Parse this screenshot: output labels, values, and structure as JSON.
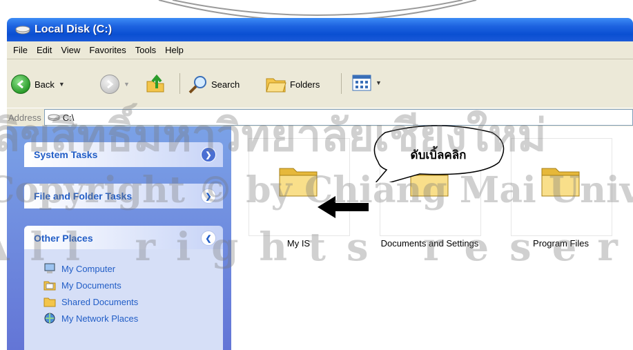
{
  "window": {
    "title": "Local Disk (C:)"
  },
  "menu": [
    "File",
    "Edit",
    "View",
    "Favorites",
    "Tools",
    "Help"
  ],
  "toolbar": {
    "back_label": "Back",
    "search_label": "Search",
    "folders_label": "Folders"
  },
  "address": {
    "label": "Address",
    "value": "C:\\"
  },
  "left_pane": {
    "system_tasks": "System Tasks",
    "file_folder_tasks": "File and Folder Tasks",
    "other_places": "Other Places",
    "other_links": [
      "My Computer",
      "My Documents",
      "Shared Documents",
      "My Network Places"
    ]
  },
  "folders": [
    "My IS",
    "Documents and Settings",
    "Program Files"
  ],
  "callout": {
    "text": "ดับเบิ้ลคลิก"
  },
  "watermark": {
    "line1": "ลิขสิทธิ์มหาวิทยาลัยเชียงใหม่",
    "line2": "Copyright © by Chiang Mai University",
    "line3": "All rights reserved"
  },
  "colors": {
    "titlebar": "#0a4fd2",
    "task_pane": "#6375d6",
    "link": "#215dc6"
  }
}
